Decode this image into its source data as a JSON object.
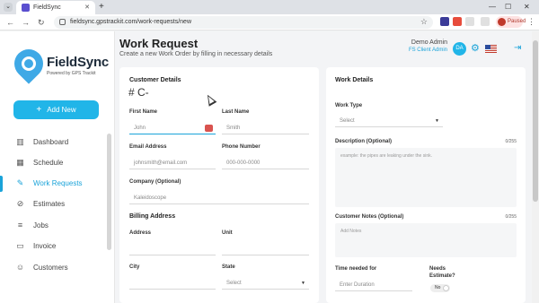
{
  "browser": {
    "tab_title": "FieldSync",
    "tab_close": "✕",
    "new_tab": "+",
    "url": "fieldsync.gpstrackit.com/work-requests/new",
    "profile_label": "Paused",
    "back": "←",
    "forward": "→",
    "reload": "↻",
    "star": "☆",
    "minimize": "—",
    "restore": "☐",
    "close": "✕",
    "menu": "⋮",
    "tab_menu": "⌄"
  },
  "sidebar": {
    "brand": "FieldSync",
    "brand_sub": "Powered by GPS Trackit",
    "add_new": "Add New",
    "items": [
      {
        "label": "Dashboard",
        "icon": "bar-chart-icon"
      },
      {
        "label": "Schedule",
        "icon": "calendar-icon"
      },
      {
        "label": "Work Requests",
        "icon": "wrench-icon",
        "active": true
      },
      {
        "label": "Estimates",
        "icon": "paperclip-icon"
      },
      {
        "label": "Jobs",
        "icon": "database-icon"
      },
      {
        "label": "Invoice",
        "icon": "document-icon"
      },
      {
        "label": "Customers",
        "icon": "users-icon"
      }
    ]
  },
  "header": {
    "title": "Work Request",
    "subtitle": "Create a new Work Order by filling in necessary details",
    "user_name": "Demo Admin",
    "user_role": "FS Client Admin",
    "avatar_initials": "DA"
  },
  "customer": {
    "title": "Customer Details",
    "number": "# C-",
    "first_name_label": "First Name",
    "first_name_placeholder": "John",
    "last_name_label": "Last Name",
    "last_name_placeholder": "Smith",
    "email_label": "Email Address",
    "email_placeholder": "johnsmith@email.com",
    "phone_label": "Phone Number",
    "phone_placeholder": "000-000-0000",
    "company_label": "Company (Optional)",
    "company_placeholder": "Kaleidoscope"
  },
  "billing": {
    "title": "Billing Address",
    "address_label": "Address",
    "unit_label": "Unit",
    "city_label": "City",
    "state_label": "State",
    "state_value": "Select"
  },
  "work": {
    "title": "Work Details",
    "type_label": "Work Type",
    "type_value": "Select",
    "desc_label": "Description (Optional)",
    "desc_counter": "0/255",
    "desc_placeholder": "example: the pipes are leaking under the sink.",
    "notes_label": "Customer Notes (Optional)",
    "notes_counter": "0/255",
    "notes_placeholder": "Add Notes",
    "time_label": "Time needed for",
    "time_placeholder": "Enter Duration",
    "estimate_label_1": "Needs",
    "estimate_label_2": "Estimate?",
    "estimate_value": "No"
  },
  "colors": {
    "accent": "#21b5e8",
    "active_nav": "#1aa3d9"
  }
}
